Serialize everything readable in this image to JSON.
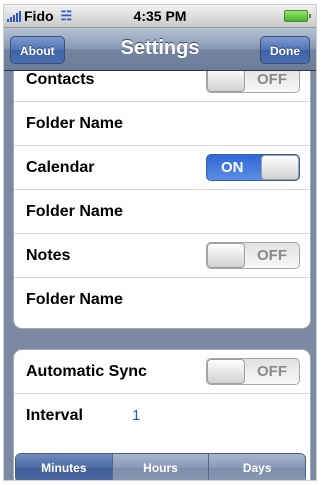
{
  "status_bar": {
    "carrier": "Fido",
    "time": "4:35 PM",
    "signal_icon": "signal-bars-icon",
    "wifi_icon": "wifi-icon",
    "battery_icon": "battery-icon"
  },
  "nav": {
    "left_button": "About",
    "title": "Settings",
    "right_button": "Done"
  },
  "group1": {
    "rows": [
      {
        "label": "Contacts",
        "switch": "OFF"
      },
      {
        "label": "Folder Name"
      },
      {
        "label": "Calendar",
        "switch": "ON"
      },
      {
        "label": "Folder Name"
      },
      {
        "label": "Notes",
        "switch": "OFF"
      },
      {
        "label": "Folder Name"
      }
    ]
  },
  "group2": {
    "automatic_sync": {
      "label": "Automatic Sync",
      "switch": "OFF"
    },
    "interval": {
      "label": "Interval",
      "value": "1"
    }
  },
  "segmented": {
    "options": [
      "Minutes",
      "Hours",
      "Days"
    ],
    "selected": "Minutes"
  },
  "colors": {
    "background": "#7b8aa2",
    "switch_on": "#2f67d6",
    "nav_button": "#4e73b6"
  }
}
